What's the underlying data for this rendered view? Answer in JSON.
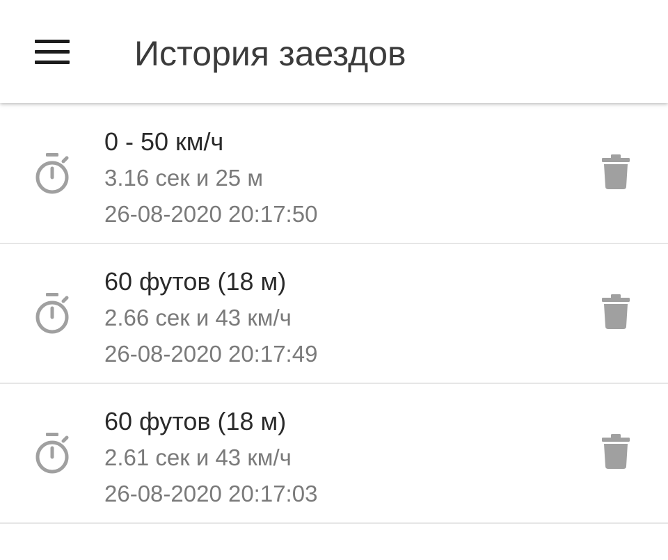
{
  "toolbar": {
    "menu_icon": "hamburger-menu-icon",
    "title": "История заездов"
  },
  "runs": [
    {
      "icon": "stopwatch-icon",
      "label": "0 - 50 км/ч",
      "result": "3.16 сек и 25 м",
      "timestamp": "26-08-2020 20:17:50",
      "action_icon": "trash-icon"
    },
    {
      "icon": "stopwatch-icon",
      "label": "60 футов (18 м)",
      "result": "2.66 сек и 43 км/ч",
      "timestamp": "26-08-2020 20:17:49",
      "action_icon": "trash-icon"
    },
    {
      "icon": "stopwatch-icon",
      "label": "60 футов (18 м)",
      "result": "2.61 сек и 43 км/ч",
      "timestamp": "26-08-2020 20:17:03",
      "action_icon": "trash-icon"
    }
  ],
  "colors": {
    "title_text": "#3b3b3b",
    "primary_text": "#2a2a2a",
    "secondary_text": "#7a7a7a",
    "icon_gray": "#a0a0a0",
    "divider": "#e6e6e6"
  }
}
